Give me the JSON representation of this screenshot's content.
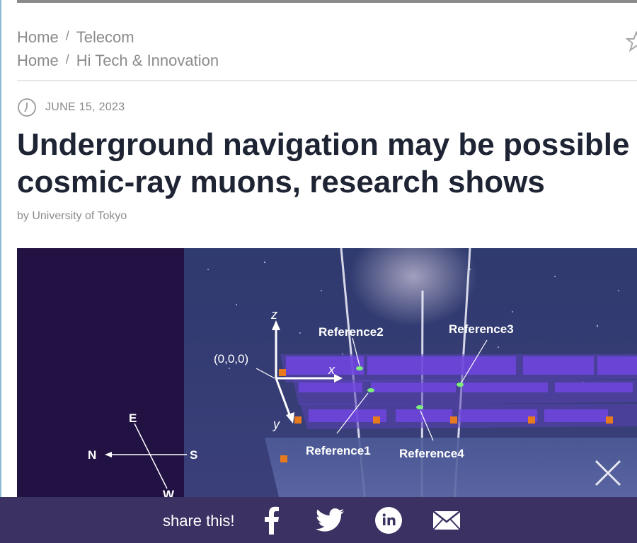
{
  "breadcrumbs": [
    {
      "home": "Home",
      "separator": "/",
      "section": "Telecom"
    },
    {
      "home": "Home",
      "separator": "/",
      "section": "Hi Tech & Innovation"
    }
  ],
  "article": {
    "date": "JUNE 15, 2023",
    "title_line1": "Underground navigation may be possible",
    "title_line2": "cosmic-ray muons, research shows",
    "byline": "by University of Tokyo"
  },
  "figure": {
    "axis_z": "z",
    "axis_x": "x",
    "axis_y": "y",
    "origin": "(0,0,0)",
    "reference1": "Reference1",
    "reference2": "Reference2",
    "reference3": "Reference3",
    "reference4": "Reference4",
    "compass_n": "N",
    "compass_s": "S",
    "compass_e": "E",
    "compass_w": "W"
  },
  "share": {
    "label": "share this!",
    "icons": [
      "facebook-icon",
      "twitter-icon",
      "linkedin-icon",
      "email-icon"
    ]
  },
  "colors": {
    "share_bar": "#3b3163",
    "headline": "#1e2433",
    "meta_text": "#8b8b8b",
    "detector_panel": "#6a3fd0",
    "sensor": "#e87a1e",
    "reference_point": "#7cf07c"
  }
}
